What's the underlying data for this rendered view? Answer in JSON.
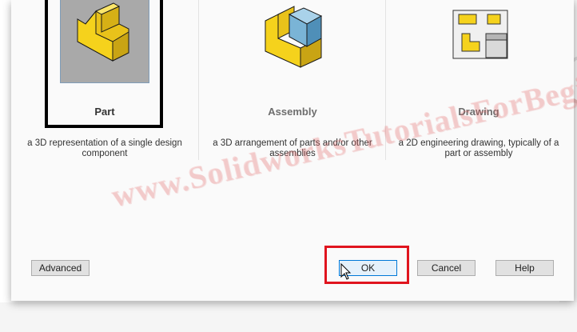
{
  "doc_types": [
    {
      "name": "Part",
      "description_line1": "a 3D representation of a single design",
      "description_line2": "component"
    },
    {
      "name": "Assembly",
      "description_line1": "a 3D arrangement of parts and/or other",
      "description_line2": "assemblies"
    },
    {
      "name": "Drawing",
      "description_line1": "a 2D engineering drawing, typically of a",
      "description_line2": "part or assembly"
    }
  ],
  "selected_type": "Part",
  "buttons": {
    "advanced": "Advanced",
    "ok": "OK",
    "cancel": "Cancel",
    "help": "Help"
  },
  "watermark": "www.SolidworksTutorialsForBeginners.com",
  "colors": {
    "icon_yellow": "#f5d21c",
    "icon_blue": "#7ab4d6",
    "highlight_red": "#e0141e",
    "selection_border": "#000000"
  }
}
